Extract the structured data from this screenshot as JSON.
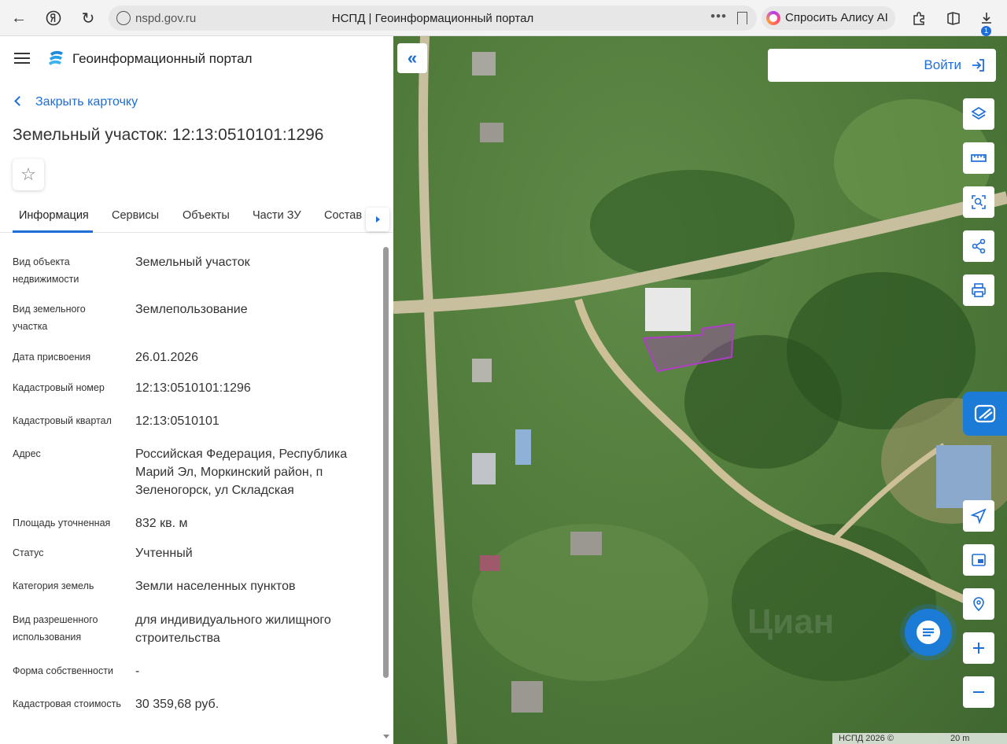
{
  "browser": {
    "url": "nspd.gov.ru",
    "tab_title": "НСПД | Геоинформационный портал",
    "alice_label": "Спросить Алису AI",
    "download_badge": "1"
  },
  "header": {
    "portal_title": "Геоинформационный портал"
  },
  "card": {
    "close_label": "Закрыть карточку",
    "title": "Земельный участок: 12:13:0510101:1296",
    "tabs": [
      "Информация",
      "Сервисы",
      "Объекты",
      "Части ЗУ",
      "Состав"
    ],
    "fields": [
      {
        "label": "Вид объекта недвижимости",
        "value": "Земельный участок"
      },
      {
        "label": "Вид земельного участка",
        "value": "Землепользование"
      },
      {
        "label": "Дата присвоения",
        "value": "26.01.2026"
      },
      {
        "label": "Кадастровый номер",
        "value": "12:13:0510101:1296"
      },
      {
        "label": "Кадастровый квартал",
        "value": "12:13:0510101"
      },
      {
        "label": "Адрес",
        "value": "Российская Федерация, Республика Марий Эл, Моркинский район, п Зеленогорск, ул Складская"
      },
      {
        "label": "Площадь уточненная",
        "value": "832 кв. м"
      },
      {
        "label": "Статус",
        "value": "Учтенный"
      },
      {
        "label": "Категория земель",
        "value": "Земли населенных пунктов"
      },
      {
        "label": "Вид разрешенного использования",
        "value": "для индивидуального жилищного строительства"
      },
      {
        "label": "Форма собственности",
        "value": "-"
      },
      {
        "label": "Кадастровая стоимость",
        "value": "30 359,68 руб."
      }
    ]
  },
  "map": {
    "login_label": "Войти",
    "attribution": "НСПД 2026 ©",
    "scale": "20 m",
    "parcel_color": "#b03cc8"
  }
}
